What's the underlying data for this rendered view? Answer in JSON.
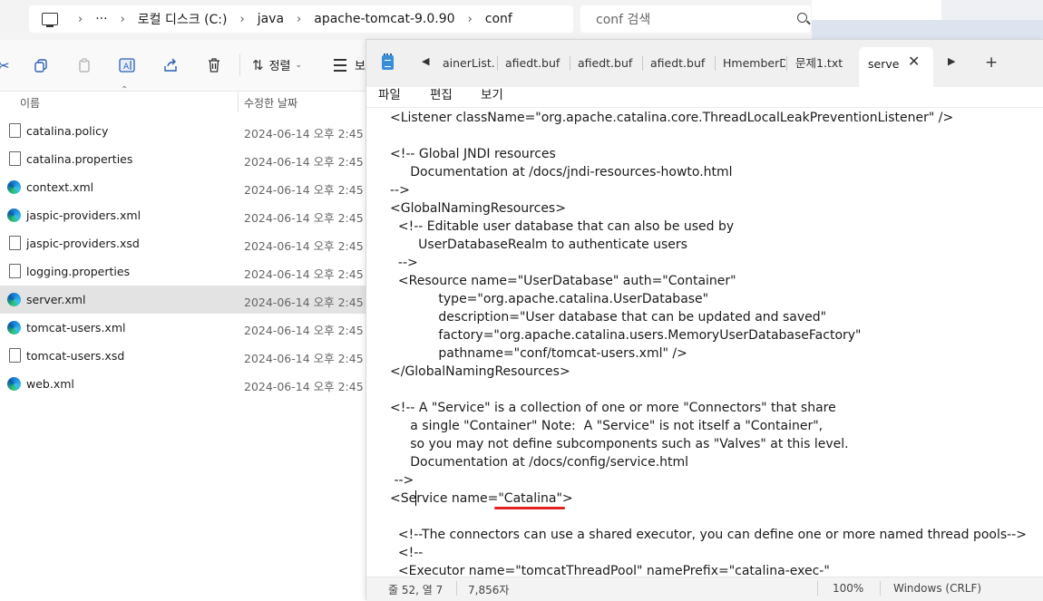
{
  "explorer": {
    "breadcrumb": {
      "overflow": "···",
      "segments": [
        "로컬 디스크 (C:)",
        "java",
        "apache-tomcat-9.0.90",
        "conf"
      ],
      "separator": "›"
    },
    "search_placeholder": "conf 검색",
    "toolbar": {
      "sort_label": "정렬",
      "view_label": "보"
    },
    "columns": {
      "name": "이름",
      "modified": "수정한 날짜"
    },
    "files": [
      {
        "name": "catalina.policy",
        "date": "2024-06-14 오후 2:45",
        "icon": "file-icon"
      },
      {
        "name": "catalina.properties",
        "date": "2024-06-14 오후 2:45",
        "icon": "file-icon"
      },
      {
        "name": "context.xml",
        "date": "2024-06-14 오후 2:45",
        "icon": "edge-icon"
      },
      {
        "name": "jaspic-providers.xml",
        "date": "2024-06-14 오후 2:45",
        "icon": "edge-icon"
      },
      {
        "name": "jaspic-providers.xsd",
        "date": "2024-06-14 오후 2:45",
        "icon": "file-icon"
      },
      {
        "name": "logging.properties",
        "date": "2024-06-14 오후 2:45",
        "icon": "file-icon"
      },
      {
        "name": "server.xml",
        "date": "2024-06-14 오후 2:45",
        "icon": "edge-icon",
        "selected": true
      },
      {
        "name": "tomcat-users.xml",
        "date": "2024-06-14 오후 2:45",
        "icon": "edge-icon"
      },
      {
        "name": "tomcat-users.xsd",
        "date": "2024-06-14 오후 2:45",
        "icon": "file-icon"
      },
      {
        "name": "web.xml",
        "date": "2024-06-14 오후 2:45",
        "icon": "edge-icon"
      }
    ]
  },
  "notepad": {
    "tabs": [
      "ainerList.S",
      "afiedt.buf",
      "afiedt.buf",
      "afiedt.buf",
      "HmemberDA",
      "문제1.txt"
    ],
    "active_tab": "server",
    "menu": [
      "파일",
      "편집",
      "보기"
    ],
    "code_lines": [
      "<Listener className=\"org.apache.catalina.core.ThreadLocalLeakPreventionListener\" />",
      "",
      "<!-- Global JNDI resources",
      "     Documentation at /docs/jndi-resources-howto.html",
      "-->",
      "<GlobalNamingResources>",
      "  <!-- Editable user database that can also be used by",
      "       UserDatabaseRealm to authenticate users",
      "  -->",
      "  <Resource name=\"UserDatabase\" auth=\"Container\"",
      "            type=\"org.apache.catalina.UserDatabase\"",
      "            description=\"User database that can be updated and saved\"",
      "            factory=\"org.apache.catalina.users.MemoryUserDatabaseFactory\"",
      "            pathname=\"conf/tomcat-users.xml\" />",
      "</GlobalNamingResources>",
      "",
      "<!-- A \"Service\" is a collection of one or more \"Connectors\" that share",
      "     a single \"Container\" Note:  A \"Service\" is not itself a \"Container\",",
      "     so you may not define subcomponents such as \"Valves\" at this level.",
      "     Documentation at /docs/config/service.html",
      " -->",
      "<Service name=\"Catalina\">",
      "",
      "  <!--The connectors can use a shared executor, you can define one or more named thread pools-->",
      "  <!--",
      "  <Executor name=\"tomcatThreadPool\" namePrefix=\"catalina-exec-\""
    ],
    "status": {
      "position": "줄 52, 열 7",
      "chars": "7,856자",
      "zoom": "100%",
      "line_ending": "Windows (CRLF)"
    },
    "highlight_color": "#e32222"
  }
}
